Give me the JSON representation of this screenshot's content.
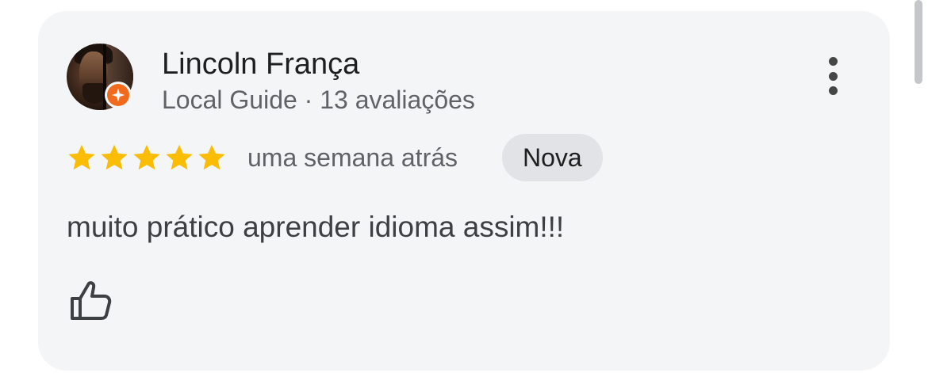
{
  "review": {
    "author_name": "Lincoln França",
    "author_meta": "Local Guide · 13 avaliações",
    "rating": 5,
    "rating_max": 5,
    "date": "uma semana atrás",
    "badge": "Nova",
    "text": "muito prático aprender idioma assim!!!"
  },
  "icons": {
    "more": "more-vert-icon",
    "like": "thumb-up-icon",
    "guide": "local-guide-star-icon"
  },
  "colors": {
    "star": "#fbbc04",
    "guide_badge": "#f26b1d",
    "card_bg": "#f4f5f7",
    "badge_bg": "#e1e3e6"
  }
}
